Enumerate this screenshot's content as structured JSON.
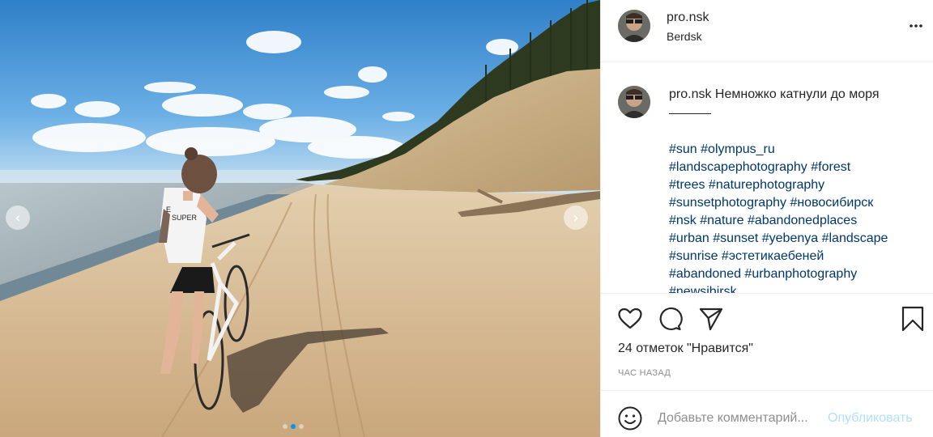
{
  "photo": {
    "description_icon": "beach-photo",
    "prev_glyph": "‹",
    "next_glyph": "›",
    "carousel": {
      "count": 3,
      "active": 2
    },
    "shirt_text_1": "E",
    "shirt_text_2": "SUPER"
  },
  "header": {
    "username": "pro.nsk",
    "location": "Berdsk",
    "more_icon": "more-horizontal-icon"
  },
  "caption": {
    "username": "pro.nsk",
    "text": "Немножко катнули до моря"
  },
  "hashtags": [
    "#sun #olympus_ru",
    "#landscapephotography #forest",
    "#trees #naturephotography",
    "#sunsetphotography #новосибирск",
    "#nsk #nature #abandonedplaces",
    "#urban #sunset #yebenya #landscape",
    "#sunrise #эстетикаебеней",
    "#abandoned #urbanphotography",
    "#newsibirsk"
  ],
  "actions": {
    "like_icon": "heart-icon",
    "comment_icon": "comment-icon",
    "share_icon": "paper-plane-icon",
    "save_icon": "bookmark-icon"
  },
  "likes_text": "24 отметок \"Нравится\"",
  "time_text": "ЧАС НАЗАД",
  "comment_box": {
    "emoji_icon": "smiley-icon",
    "placeholder": "Добавьте комментарий...",
    "publish_label": "Опубликовать",
    "publish_color": "#b2dffc"
  },
  "colors": {
    "hashtag": "#00376b",
    "accent": "#0095f6",
    "muted": "#8e8e8e"
  }
}
